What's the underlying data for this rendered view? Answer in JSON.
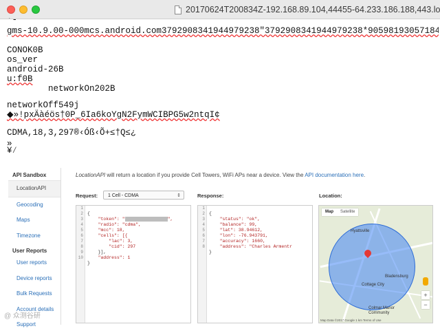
{
  "window": {
    "title": "20170624T200834Z-192.168.89.104,44455-64.233.186.188,443.log"
  },
  "log_lines": [
    "gms-10.9.00-000mcs.android.com3792908341944979238\"3792908341944979238*905981930571843",
    "CONOK0B",
    "os_ver",
    "android-26B",
    "u:f0B",
    "        networkOn202B",
    "networkOff549j",
    "◆»!pxÄàéös†0P_6Ia6koYgN2FymWCIBPG5w2ntqI¢",
    "CDMA,18,3,297®‹Óß‹Õ+≤†Q≤¿",
    "»",
    "¥⁄"
  ],
  "sandbox": {
    "sidebar": {
      "heading": "API Sandbox",
      "items": [
        "LocationAPI",
        "Geocoding",
        "Maps",
        "Timezone"
      ],
      "subheading": "User Reports",
      "sub_items": [
        "User reports",
        "Device reports",
        "Bulk Requests",
        "Account details",
        "Support"
      ]
    },
    "intro": {
      "api": "LocationAPI",
      "text": " will return a location if you provide Cell Towers, WiFi APs near a device. View the ",
      "link": "API documentation here",
      "end": "."
    },
    "request_label": "Request:",
    "request_select": "1 Cell - CDMA",
    "response_label": "Response:",
    "location_label": "Location:",
    "request_lines": [
      "{",
      "    \"token\": \"",
      "    \"radio\": \"cdma\",",
      "    \"mcc\": 18,",
      "    \"cells\": [{",
      "        \"lac\": 3,",
      "        \"cid\": 297",
      "    }],",
      "    \"address\": 1",
      "}"
    ],
    "response_lines": [
      "{",
      "    \"status\": \"ok\",",
      "    \"balance\": 99,",
      "    \"lat\": 38.94612,",
      "    \"lon\": -76.943791,",
      "    \"accuracy\": 1660,",
      "    \"address\": \"Charles Armentr",
      "}"
    ],
    "map": {
      "tabs": [
        "Map",
        "Satellite"
      ],
      "places": [
        "Hyattsville",
        "Cottage City",
        "Bladensburg",
        "Colmar Manor Community"
      ],
      "zoom_in": "+",
      "zoom_out": "−",
      "footer": "Map Data ©2017 Google   1 km     Terms of Use"
    }
  },
  "watermark": "@ 众测谷研"
}
